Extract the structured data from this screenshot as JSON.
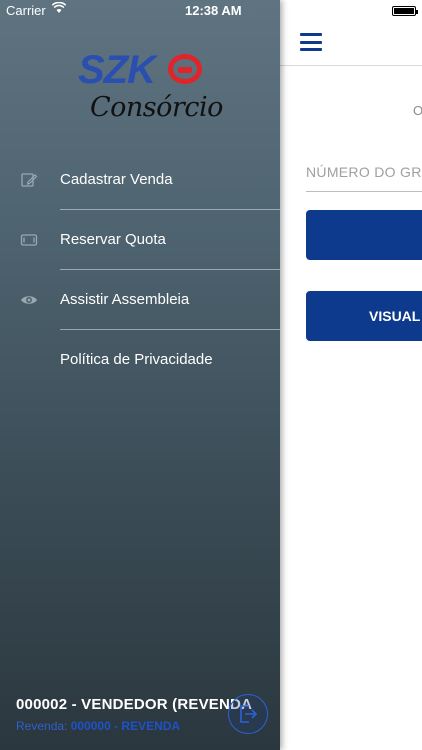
{
  "status": {
    "carrier": "Carrier",
    "time": "12:38 AM"
  },
  "logo": {
    "brand": "SZK",
    "subtitle": "Consórcio"
  },
  "menu": {
    "items": [
      {
        "label": "Cadastrar Venda",
        "icon": "edit-icon"
      },
      {
        "label": "Reservar Quota",
        "icon": "quota-icon"
      },
      {
        "label": "Assistir Assembleia",
        "icon": "eye-icon"
      },
      {
        "label": "Política de Privacidade",
        "icon": ""
      }
    ]
  },
  "footer": {
    "user": "000002 - VENDEDOR (REVENDA",
    "revenda_label": "Revenda:",
    "revenda_value": "000000 - REVENDA"
  },
  "main": {
    "top_label": "O",
    "group_placeholder": "NÚMERO DO GRU",
    "button2_label": "VISUAL"
  },
  "colors": {
    "accent": "#0d3a8c",
    "logo_blue": "#2a4fb0",
    "logo_red": "#e0242a"
  }
}
